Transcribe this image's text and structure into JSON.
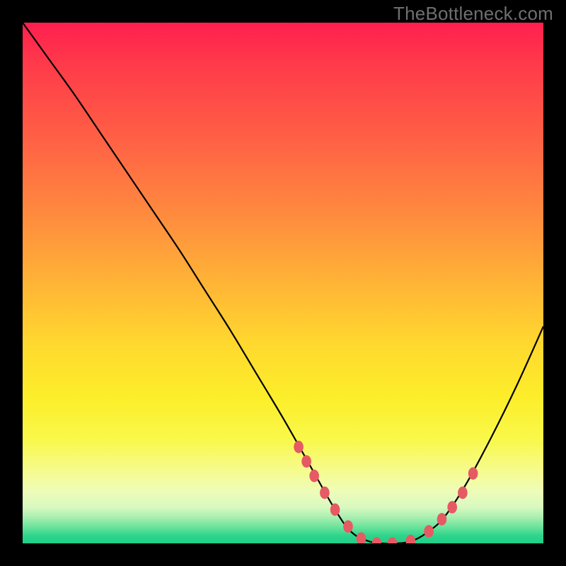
{
  "watermark": "TheBottleneck.com",
  "chart_data": {
    "type": "line",
    "title": "",
    "xlabel": "",
    "ylabel": "",
    "xlim": [
      0,
      100
    ],
    "ylim": [
      0,
      108
    ],
    "series": [
      {
        "name": "bottleneck-curve",
        "x": [
          0,
          5,
          10,
          15,
          20,
          25,
          30,
          35,
          40,
          45,
          50,
          55,
          60,
          63,
          66,
          69,
          72,
          75,
          78,
          81,
          85,
          90,
          95,
          100
        ],
        "y": [
          108,
          100.5,
          93,
          85,
          77,
          69,
          61,
          52.5,
          44,
          35,
          26,
          16.5,
          7,
          2.5,
          0.6,
          0,
          0,
          0.6,
          2.5,
          5.5,
          12,
          22,
          33,
          45
        ]
      },
      {
        "name": "highlight-dots",
        "x": [
          53.0,
          54.5,
          56.0,
          58.0,
          60.0,
          62.5,
          65.0,
          68.0,
          71.0,
          74.5,
          78.0,
          80.5,
          82.5,
          84.5,
          86.5
        ],
        "y": [
          20.0,
          17.0,
          14.0,
          10.5,
          7.0,
          3.5,
          1.0,
          0.0,
          0.0,
          0.5,
          2.5,
          5.0,
          7.5,
          10.5,
          14.5
        ]
      }
    ],
    "colors": {
      "curve": "#000000",
      "dots": "#e55a63",
      "gradient_top": "#ff1f4e",
      "gradient_mid": "#ffd92e",
      "gradient_bottom": "#1ecf88",
      "background": "#000000"
    }
  }
}
